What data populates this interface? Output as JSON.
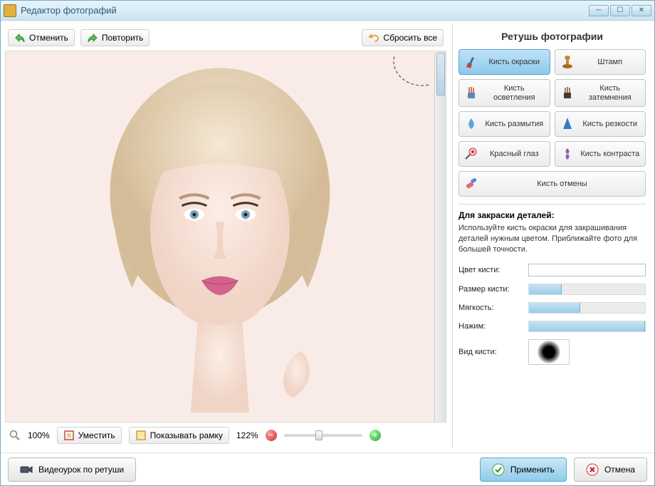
{
  "window": {
    "title": "Редактор фотографий"
  },
  "toolbar": {
    "undo": "Отменить",
    "redo": "Повторить",
    "reset": "Сбросить все"
  },
  "zoombar": {
    "zoom": "100%",
    "fit": "Уместить",
    "show_frame": "Показывать рамку",
    "zoom2": "122%"
  },
  "panel": {
    "title": "Ретушь фотографии",
    "tools": [
      {
        "id": "paint-brush",
        "label": "Кисть окраски",
        "active": true
      },
      {
        "id": "stamp",
        "label": "Штамп",
        "active": false
      },
      {
        "id": "lighten-brush",
        "label": "Кисть осветления",
        "active": false
      },
      {
        "id": "darken-brush",
        "label": "Кисть затемнения",
        "active": false
      },
      {
        "id": "blur-brush",
        "label": "Кисть размытия",
        "active": false
      },
      {
        "id": "sharpen-brush",
        "label": "Кисть резкости",
        "active": false
      },
      {
        "id": "red-eye",
        "label": "Красный глаз",
        "active": false
      },
      {
        "id": "contrast-brush",
        "label": "Кисть контраста",
        "active": false
      },
      {
        "id": "undo-brush",
        "label": "Кисть отмены",
        "active": false,
        "wide": true
      }
    ],
    "desc_title": "Для закраски деталей:",
    "desc_body": "Используйте кисть окраски для закрашивания деталей нужным цветом. Приближайте фото для большей точности.",
    "params": {
      "brush_color_label": "Цвет кисти:",
      "brush_color": "#ffffff",
      "brush_size_label": "Размер кисти:",
      "brush_size_pct": 28,
      "softness_label": "Мягкость:",
      "softness_pct": 44,
      "opacity_label": "Нажим:",
      "opacity_pct": 100,
      "brush_view_label": "Вид кисти:"
    }
  },
  "footer": {
    "tutorial": "Видеоурок по ретуши",
    "apply": "Применить",
    "cancel": "Отмена"
  }
}
